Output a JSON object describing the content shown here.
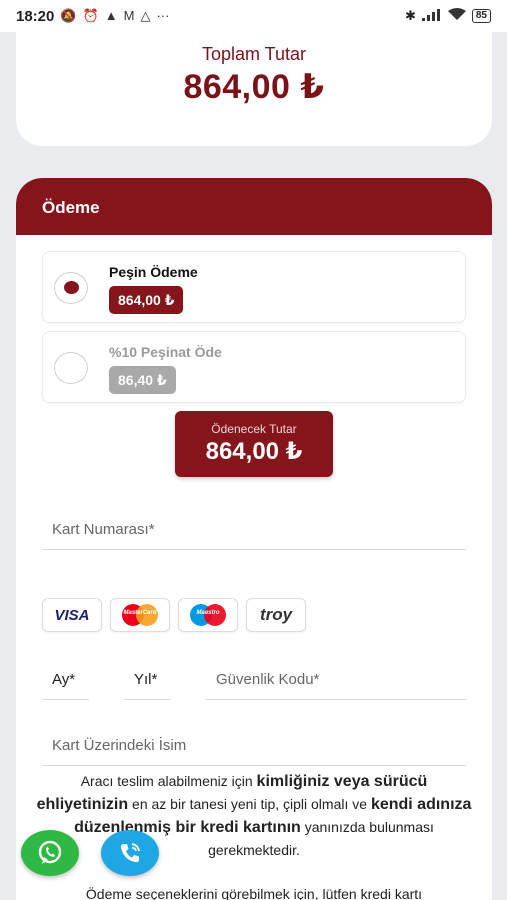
{
  "status_bar": {
    "time": "18:20",
    "battery": "85",
    "dots": "···"
  },
  "summary": {
    "label": "Toplam Tutar",
    "amount": "864,00 ₺"
  },
  "payment": {
    "header": "Ödeme",
    "options": [
      {
        "title": "Peşin Ödeme",
        "amount": "864,00 ₺",
        "selected": true
      },
      {
        "title": "%10 Peşinat Öde",
        "amount": "86,40 ₺",
        "selected": false
      }
    ],
    "payable_label": "Ödenecek Tutar",
    "payable_amount": "864,00 ₺",
    "card_number_placeholder": "Kart Numarası*",
    "month_placeholder": "Ay*",
    "year_placeholder": "Yıl*",
    "cvv_placeholder": "Güvenlik Kodu*",
    "name_placeholder": "Kart Üzerindeki İsim",
    "brands": [
      "VISA",
      "MasterCard",
      "Maestro",
      "troy"
    ]
  },
  "info": {
    "p1_a": "Aracı teslim alabilmeniz için ",
    "p1_b": "kimliğiniz veya sürücü ehliyetinizin",
    "p1_c": " en az bir tanesi yeni tip, çipli olmalı ve ",
    "p1_d": "kendi adınıza düzenlenmiş bir kredi kartının",
    "p1_e": " yanınızda bulunması gerekmektedir.",
    "p2": "Ödeme seçeneklerini görebilmek için, lütfen kredi kartı"
  },
  "colors": {
    "brand": "#86141b",
    "whatsapp": "#2fb844",
    "call": "#1fa7e5"
  }
}
